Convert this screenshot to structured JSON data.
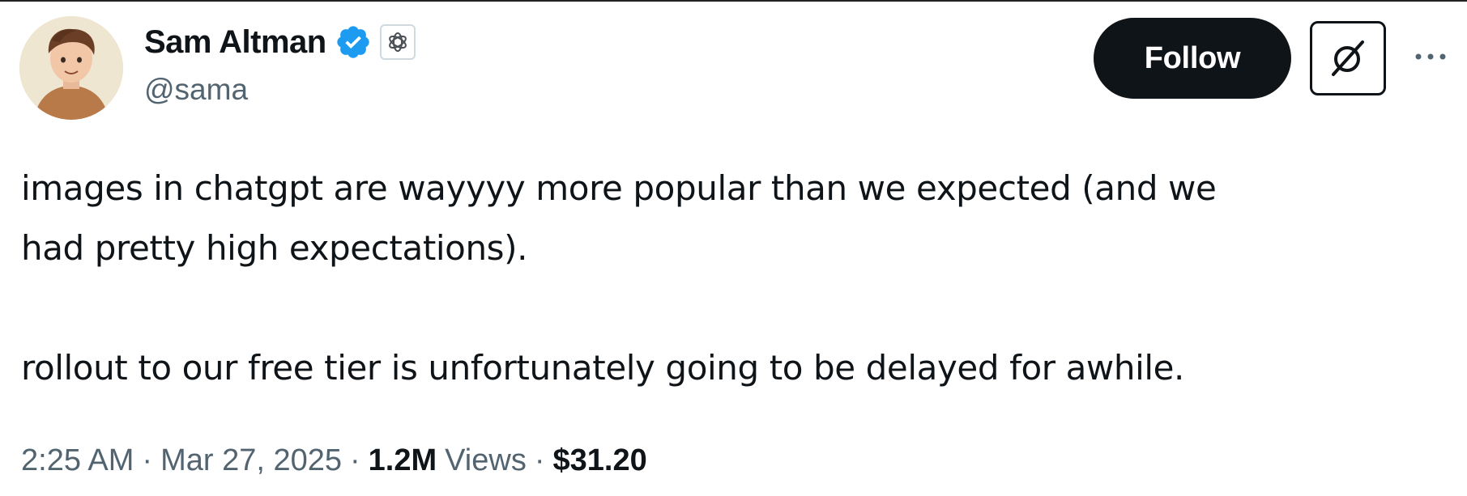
{
  "tweet": {
    "author": {
      "display_name": "Sam Altman",
      "handle": "@sama",
      "verified": true,
      "affiliation_badge": "openai-logo-icon"
    },
    "actions": {
      "follow_label": "Follow",
      "grok_icon": "grok-icon",
      "more_icon": "more-options-icon"
    },
    "text": {
      "line_1": "images in chatgpt are wayyyy more popular than we expected (and we",
      "line_2": "had pretty high expectations).",
      "line_3": "rollout to our free tier is unfortunately going to be delayed for awhile."
    },
    "meta": {
      "time": "2:25 AM",
      "date": "Mar 27, 2025",
      "views_count": "1.2M",
      "views_label": "Views",
      "price": "$31.20",
      "separator": "·"
    }
  },
  "colors": {
    "text_primary": "#0f1419",
    "text_secondary": "#536471",
    "verified_blue": "#1d9bf0",
    "button_dark": "#0f1419"
  }
}
